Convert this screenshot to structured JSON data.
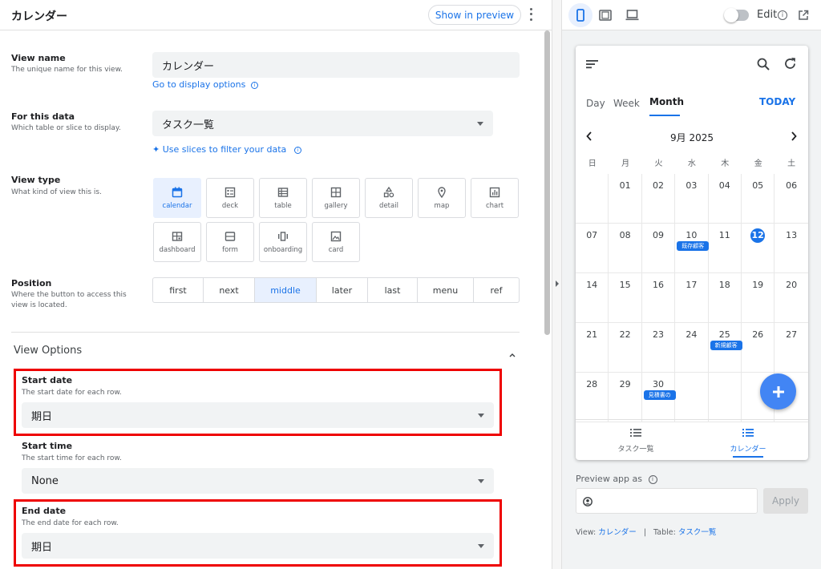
{
  "header": {
    "title": "カレンダー",
    "preview_button": "Show in preview"
  },
  "view_name": {
    "label": "View name",
    "desc": "The unique name for this view.",
    "value": "カレンダー",
    "link": "Go to display options"
  },
  "for_data": {
    "label": "For this data",
    "desc": "Which table or slice to display.",
    "value": "タスク一覧",
    "link": "Use slices to filter your data"
  },
  "view_type": {
    "label": "View type",
    "desc": "What kind of view this is.",
    "options": [
      "calendar",
      "deck",
      "table",
      "gallery",
      "detail",
      "map",
      "chart",
      "dashboard",
      "form",
      "onboarding",
      "card"
    ],
    "selected": "calendar"
  },
  "position": {
    "label": "Position",
    "desc": "Where the button to access this view is located.",
    "options": [
      "first",
      "next",
      "middle",
      "later",
      "last",
      "menu",
      "ref"
    ],
    "selected": "middle"
  },
  "view_options": {
    "title": "View Options"
  },
  "start_date": {
    "label": "Start date",
    "desc": "The start date for each row.",
    "value": "期日"
  },
  "start_time": {
    "label": "Start time",
    "desc": "The start time for each row.",
    "value": "None"
  },
  "end_date": {
    "label": "End date",
    "desc": "The end date for each row.",
    "value": "期日"
  },
  "preview_toolbar": {
    "edit_label": "Edit"
  },
  "calendar": {
    "tabs": [
      "Day",
      "Week",
      "Month"
    ],
    "active_tab": "Month",
    "today_button": "TODAY",
    "month_label": "9月 2025",
    "weekdays": [
      "日",
      "月",
      "火",
      "水",
      "木",
      "金",
      "土"
    ],
    "weeks": [
      [
        "",
        "01",
        "02",
        "03",
        "04",
        "05",
        "06"
      ],
      [
        "07",
        "08",
        "09",
        "10",
        "11",
        "12",
        "13"
      ],
      [
        "14",
        "15",
        "16",
        "17",
        "18",
        "19",
        "20"
      ],
      [
        "21",
        "22",
        "23",
        "24",
        "25",
        "26",
        "27"
      ],
      [
        "28",
        "29",
        "30",
        "",
        "",
        "",
        ""
      ]
    ],
    "today": "12",
    "events": [
      {
        "day": "10",
        "label": "既存顧客"
      },
      {
        "day": "25",
        "label": "新規顧客"
      },
      {
        "day": "30",
        "label": "見積書の"
      }
    ],
    "bottom_nav": [
      {
        "label": "タスク一覧"
      },
      {
        "label": "カレンダー",
        "active": true
      }
    ]
  },
  "preview_as": {
    "label": "Preview app as",
    "apply": "Apply"
  },
  "footer": {
    "view_prefix": "View:",
    "view_value": "カレンダー",
    "sep": "|",
    "table_prefix": "Table:",
    "table_value": "タスク一覧"
  }
}
